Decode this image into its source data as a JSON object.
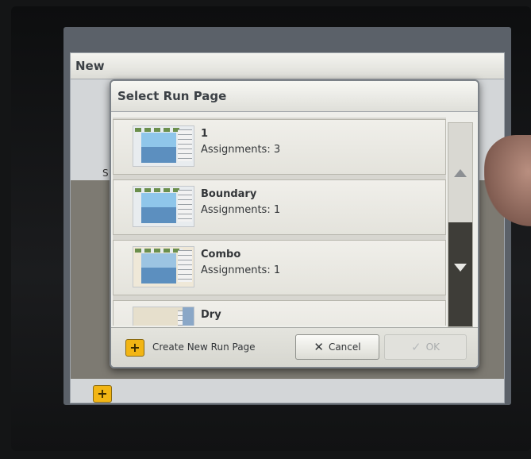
{
  "background": {
    "window_title_fragment": "New",
    "window_text_fragment": "S"
  },
  "dialog": {
    "title": "Select Run Page",
    "items": [
      {
        "name": "1",
        "assignments": "Assignments: 3"
      },
      {
        "name": "Boundary",
        "assignments": "Assignments: 1"
      },
      {
        "name": "Combo",
        "assignments": "Assignments: 1"
      },
      {
        "name": "Dry",
        "assignments": ""
      }
    ],
    "scroll_up_icon": "triangle-up-icon",
    "scroll_down_icon": "triangle-down-icon"
  },
  "footer": {
    "create_label": "Create New Run Page",
    "create_icon": "plus-icon",
    "cancel_label": "Cancel",
    "cancel_icon": "x-icon",
    "ok_label": "OK",
    "ok_icon": "checkmark-icon"
  },
  "colors": {
    "accent_yellow": "#f2b514",
    "scroll_thumb": "#3e3d38"
  }
}
